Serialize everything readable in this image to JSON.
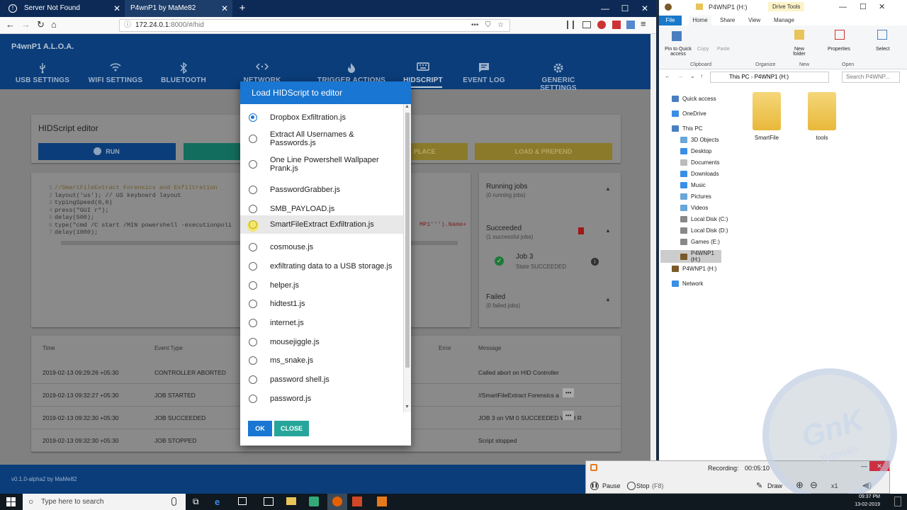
{
  "browser": {
    "tabs": [
      {
        "title": "Server Not Found"
      },
      {
        "title": "P4wnP1 by MaMe82"
      }
    ],
    "new_tab": "+",
    "url_host": "172.24.0.1",
    "url_path": ":8000/#/hid",
    "dots": "•••"
  },
  "app": {
    "brand": "P4wnP1 A.L.O.A.",
    "nav": [
      {
        "label": "USB SETTINGS",
        "icon": "usb-icon"
      },
      {
        "label": "WIFI SETTINGS",
        "icon": "wifi-icon"
      },
      {
        "label": "BLUETOOTH",
        "icon": "bluetooth-icon"
      },
      {
        "label": "NETWORK SETTINGS",
        "icon": "network-icon"
      },
      {
        "label": "TRIGGER ACTIONS",
        "icon": "fire-icon"
      },
      {
        "label": "HIDSCRIPT",
        "icon": "keyboard-icon"
      },
      {
        "label": "EVENT LOG",
        "icon": "message-icon"
      },
      {
        "label": "GENERIC SETTINGS",
        "icon": "gear-icon"
      }
    ],
    "editor": {
      "title": "HIDScript editor",
      "run": "RUN",
      "replace": "PLACE",
      "load_prepend": "LOAD & PREPEND"
    },
    "code": [
      "//SmartFileExtract Forensics and Exfiltration",
      "layout('us');   // US keyboard layout",
      "typingSpeed(0,0)",
      "press(\"GUI r\");",
      "delay(500);",
      "type(\"cmd /C start /MIN powershell -executionpoli",
      "delay(1000);"
    ],
    "code_tail": "MP1''').Name+",
    "jobs": {
      "running_title": "Running jobs",
      "running_sub": "(0 running jobs)",
      "succeeded_title": "Succeeded",
      "succeeded_sub": "(1 successful jobs)",
      "job_name": "Job 3",
      "job_state": "State SUCCEEDED",
      "failed_title": "Failed",
      "failed_sub": "(0 failed jobs)"
    },
    "log": {
      "headers": [
        "Time",
        "Event Type",
        "Error",
        "Message"
      ],
      "rows": [
        {
          "time": "2019-02-13 09:29:26 +05:30",
          "type": "CONTROLLER ABORTED",
          "message": "Called abort on HID Controller"
        },
        {
          "time": "2019-02-13 09:32:27 +05:30",
          "type": "JOB STARTED",
          "message": "//SmartFileExtract Forensics a"
        },
        {
          "time": "2019-02-13 09:32:30 +05:30",
          "type": "JOB SUCCEEDED",
          "message": "JOB 3 on VM 0 SUCCEEDED WITH R"
        },
        {
          "time": "2019-02-13 09:32:30 +05:30",
          "type": "JOB STOPPED",
          "message": "Script stopped"
        }
      ],
      "more": "•••"
    },
    "footer": "v0.1.0-alpha2 by MaMe82"
  },
  "modal": {
    "title": "Load HIDScript to editor",
    "options": [
      "Dropbox Exfiltration.js",
      "Extract All Usernames & Passwords.js",
      "One Line Powershell Wallpaper Prank.js",
      "PasswordGrabber.js",
      "SMB_PAYLOAD.js",
      "SmartFileExtract Exfiltration.js",
      "cosmouse.js",
      "exfiltrating data to a USB storage.js",
      "helper.js",
      "hidtest1.js",
      "internet.js",
      "mousejiggle.js",
      "ms_snake.js",
      "password shell.js",
      "password.js"
    ],
    "selected_index": 0,
    "hover_index": 5,
    "ok": "OK",
    "close": "CLOSE"
  },
  "explorer": {
    "title": "P4WNP1 (H:)",
    "drive_tools": "Drive Tools",
    "ribbon_tabs": [
      "File",
      "Home",
      "Share",
      "View",
      "Manage"
    ],
    "ribbon_items": [
      "Pin to Quick access",
      "Copy",
      "Paste",
      "New folder",
      "Properties",
      "Select"
    ],
    "ribbon_groups": [
      "Clipboard",
      "Organize",
      "New",
      "Open"
    ],
    "address": [
      "This PC",
      "P4WNP1 (H:)"
    ],
    "search_placeholder": "Search P4WNP...",
    "tree": [
      "Quick access",
      "OneDrive",
      "This PC",
      "3D Objects",
      "Desktop",
      "Documents",
      "Downloads",
      "Music",
      "Pictures",
      "Videos",
      "Local Disk (C:)",
      "Local Disk (D:)",
      "Games (E:)",
      "P4WNP1 (H:)",
      "P4WNP1 (H:)",
      "Network"
    ],
    "folders": [
      "SmartFile",
      "tools"
    ]
  },
  "recorder": {
    "label": "Recording:",
    "time": "00:05:10",
    "pause": "Pause",
    "stop": "Stop",
    "stop_key": "(F8)",
    "draw": "Draw",
    "zoom": "x1"
  },
  "watermark": {
    "line1": "GnK",
    "line2": "Tutorials"
  },
  "taskbar": {
    "search": "Type here to search",
    "time": "09:37 PM",
    "date": "13-02-2019"
  }
}
